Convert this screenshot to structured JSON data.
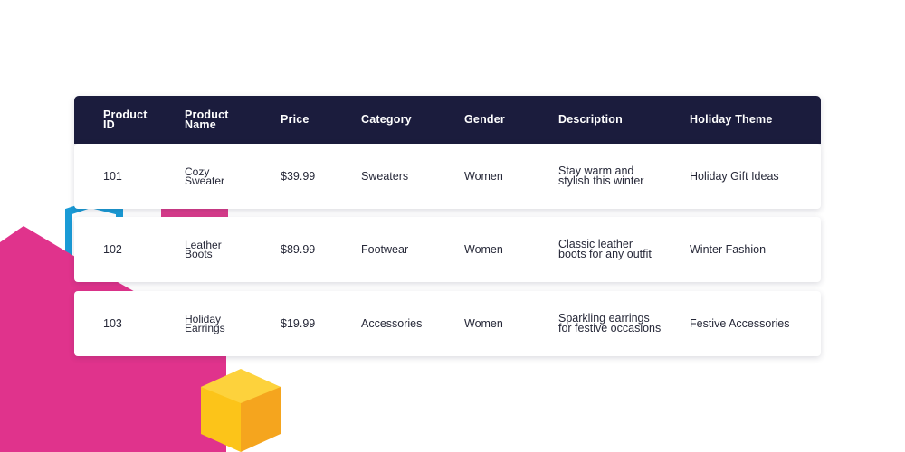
{
  "colors": {
    "header_bg": "#1b1c3d",
    "pink": "#e0338c",
    "blue": "#1a9bd6",
    "yellow": "#fbbf24",
    "row_bg": "#ffffff"
  },
  "table": {
    "headers": [
      "Product\nID",
      "Product\nName",
      "Price",
      "Category",
      "Gender",
      "Description",
      "Holiday Theme"
    ],
    "rows": [
      {
        "id": "101",
        "name": "Cozy\nSweater",
        "price": "$39.99",
        "category": "Sweaters",
        "gender": "Women",
        "description": "Stay warm and\nstylish this winter",
        "theme": "Holiday Gift Ideas"
      },
      {
        "id": "102",
        "name": "Leather\nBoots",
        "price": "$89.99",
        "category": "Footwear",
        "gender": "Women",
        "description": "Classic leather\nboots for any outfit",
        "theme": "Winter Fashion"
      },
      {
        "id": "103",
        "name": "Holiday\nEarrings",
        "price": "$19.99",
        "category": "Accessories",
        "gender": "Women",
        "description": "Sparkling earrings\nfor festive occasions",
        "theme": "Festive Accessories"
      }
    ]
  }
}
